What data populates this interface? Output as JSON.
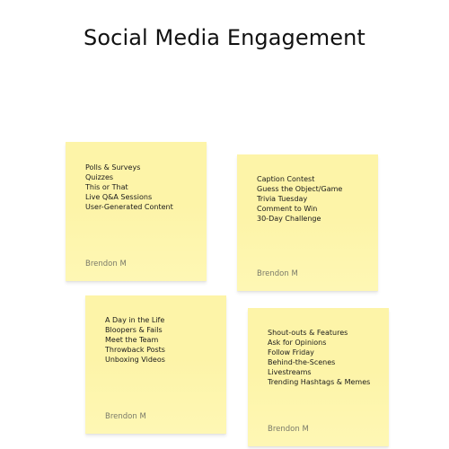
{
  "title": "Social Media Engagement",
  "colors": {
    "note_fill": "#fdf4a8",
    "author_text": "#7a7a6a",
    "body_text": "#1a1a1a"
  },
  "notes": [
    {
      "items": [
        "Polls & Surveys",
        "Quizzes",
        "This or That",
        "Live Q&A Sessions",
        "User-Generated Content"
      ],
      "author": "Brendon M"
    },
    {
      "items": [
        "Caption Contest",
        "Guess the Object/Game",
        "Trivia Tuesday",
        "Comment to Win",
        "30-Day Challenge"
      ],
      "author": "Brendon M"
    },
    {
      "items": [
        "A Day in the Life",
        "Bloopers & Fails",
        "Meet the Team",
        "Throwback Posts",
        "Unboxing Videos"
      ],
      "author": "Brendon M"
    },
    {
      "items": [
        "Shout-outs & Features",
        "Ask for Opinions",
        "Follow Friday",
        "Behind-the-Scenes",
        "Livestreams",
        "Trending Hashtags & Memes"
      ],
      "author": "Brendon M"
    }
  ]
}
